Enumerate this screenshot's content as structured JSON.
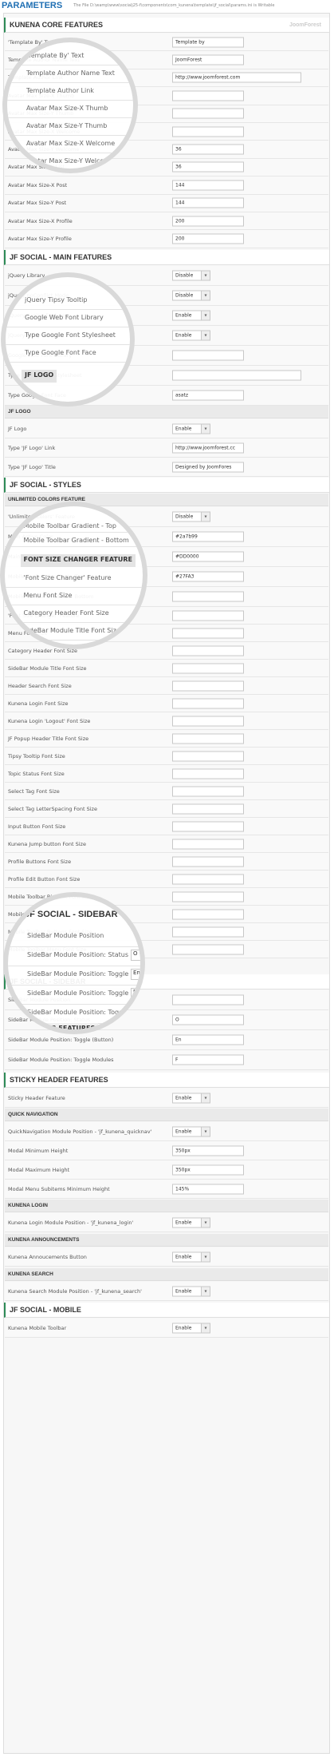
{
  "header": {
    "title": "PARAMETERS",
    "path": "The File D:\\wamp\\www\\socialj25-f\\components\\com_kunena\\template\\jf_social\\params.ini is Writable"
  },
  "logo_text": "JoomForest",
  "dropdown_arrow": "▾",
  "sections": {
    "core": "KUNENA CORE FEATURES",
    "main": "JF SOCIAL - MAIN FEATURES",
    "jflogo": "JF LOGO",
    "styles": "JF SOCIAL - STYLES",
    "unlimited": "UNLIMITED COLORS FEATURE",
    "sidebar": "JF SOCIAL - SIDEBAR",
    "sticky": "STICKY HEADER FEATURES",
    "quicknav": "QUICK NAVIGATION",
    "login": "KUNENA LOGIN",
    "announce": "KUNENA ANNOUNCEMENTS",
    "search": "KUNENA SEARCH",
    "mobile": "JF SOCIAL - MOBILE"
  },
  "core_rows": [
    {
      "label": "'Template By' Text",
      "value": "Template by"
    },
    {
      "label": "Template Author Name Text",
      "value": "JoomForest"
    },
    {
      "label": "Template Author Link",
      "value": "http://www.joomforest.com"
    },
    {
      "label": "Avatar Max Size-X Thumb",
      "value": ""
    },
    {
      "label": "Avatar Max Size-Y Thumb",
      "value": ""
    },
    {
      "label": "Avatar Max Size-X Welcome",
      "value": ""
    },
    {
      "label": "Avatar Max Size-Y Welcome",
      "value": "36"
    },
    {
      "label": "Avatar Max Size-Y List",
      "value": "36"
    },
    {
      "label": "Avatar Max Size-X Post",
      "value": "144"
    },
    {
      "label": "Avatar Max Size-Y Post",
      "value": "144"
    },
    {
      "label": "Avatar Max Size-X Profile",
      "value": "200"
    },
    {
      "label": "Avatar Max Size-Y Profile",
      "value": "200"
    }
  ],
  "main_rows": [
    {
      "label": "jQuery Library",
      "value": "Disable"
    },
    {
      "label": "jQuery noConflict Mode",
      "value": "Disable"
    },
    {
      "label": "jQuery Easing Features",
      "value": "Enable"
    },
    {
      "label": "jQuery Tipsy Tooltip",
      "value": "Enable"
    },
    {
      "label": "Google Web Font Library",
      "value": ""
    },
    {
      "label": "Type Google Font Stylesheet",
      "value": ""
    },
    {
      "label": "Type Google Font Face",
      "value": "asatz"
    }
  ],
  "logo_rows": [
    {
      "label": "JF Logo",
      "value": "Enable"
    },
    {
      "label": "Type 'JF Logo' Link",
      "value": "http://www.joomforest.cc"
    },
    {
      "label": "Type 'JF Logo' Title",
      "value": "Designed by JoomFores"
    }
  ],
  "styles_rows": [
    {
      "label": "'Unlimited Colors' Feature",
      "value": "Disable"
    },
    {
      "label": "Main Active Color",
      "value": "#2a7b99"
    },
    {
      "label": "Main Inactive Color",
      "value": "#DD0000"
    },
    {
      "label": "Mobile Toolbar Gradient - Top",
      "value": "#27FA3"
    },
    {
      "label": "Mobile Toolbar Gradient - Bottom",
      "value": ""
    }
  ],
  "font_rows": [
    {
      "label": "'Font Size Changer' Feature",
      "value": ""
    },
    {
      "label": "Menu Font Size",
      "value": ""
    },
    {
      "label": "Category Header Font Size",
      "value": ""
    },
    {
      "label": "SideBar Module Title Font Size",
      "value": ""
    },
    {
      "label": "Header Search Font Size",
      "value": ""
    },
    {
      "label": "Kunena Login Font Size",
      "value": ""
    },
    {
      "label": "Kunena Login 'Logout' Font Size",
      "value": ""
    },
    {
      "label": "JF Popup Header Title Font Size",
      "value": ""
    },
    {
      "label": "Tipsy Tooltip Font Size",
      "value": ""
    },
    {
      "label": "Topic Status Font Size",
      "value": ""
    },
    {
      "label": "Select Tag Font Size",
      "value": ""
    },
    {
      "label": "Select Tag LetterSpacing Font Size",
      "value": ""
    },
    {
      "label": "Input Button Font Size",
      "value": ""
    },
    {
      "label": "Kunena Jump button Font Size",
      "value": ""
    },
    {
      "label": "Profile Buttons Font Size",
      "value": ""
    },
    {
      "label": "Profile Edit Button Font Size",
      "value": ""
    },
    {
      "label": "Mobile Toolbar Big Text Font Size",
      "value": ""
    },
    {
      "label": "Mobile Toolbar Small Text Font Size",
      "value": ""
    },
    {
      "label": "Mobile Toolbar Buttons Font Size",
      "value": ""
    },
    {
      "label": "Mobile Toolbar Menu Font Size",
      "value": ""
    }
  ],
  "sidebar_rows": [
    {
      "label": "SideBar Module Position",
      "value": ""
    },
    {
      "label": "SideBar Module Position: Status",
      "value": "O"
    },
    {
      "label": "SideBar Module Position: Toggle (Button)",
      "value": "En"
    },
    {
      "label": "SideBar Module Position: Toggle Modules",
      "value": "F"
    }
  ],
  "sticky_rows": [
    {
      "label": "Sticky Header Feature",
      "value": "Enable"
    }
  ],
  "quicknav_rows": [
    {
      "label": "QuickNavigation Module Position - 'jf_kunena_quicknav'",
      "value": "Enable"
    },
    {
      "label": "Modal Minimum Height",
      "value": "350px"
    },
    {
      "label": "Modal Maximum Height",
      "value": "350px"
    },
    {
      "label": "Modal Menu Subitems Minimum Height",
      "value": "145%"
    }
  ],
  "login_rows": [
    {
      "label": "Kunena Login Module Position - 'jf_kunena_login'",
      "value": "Enable"
    }
  ],
  "announce_rows": [
    {
      "label": "Kunena Annoucements Button",
      "value": "Enable"
    }
  ],
  "search_rows": [
    {
      "label": "Kunena Search Module Position - 'jf_kunena_search'",
      "value": "Enable"
    }
  ],
  "mobile_rows": [
    {
      "label": "Kunena Mobile Toolbar",
      "value": "Enable"
    }
  ],
  "magnifiers": {
    "m1": [
      "'Template By' Text",
      "Template Author Name Text",
      "Template Author Link",
      "Avatar Max Size-X Thumb",
      "Avatar Max Size-Y Thumb",
      "Avatar Max Size-X Welcome",
      "Avatar Max Size-Y Welcome"
    ],
    "m2": [
      "jQuery Tipsy Tooltip",
      "Google Web Font Library",
      "Type Google Font Stylesheet",
      "Type Google Font Face"
    ],
    "m2_head": "JF LOGO",
    "m3_top": [
      "Mobile Toolbar Gradient - Top",
      "Mobile Toolbar Gradient - Bottom"
    ],
    "m3_head": "FONT SIZE CHANGER FEATURE",
    "m3": [
      "'Font Size Changer' Feature",
      "Menu Font Size",
      "Category Header Font Size",
      "SideBar Module Title Font Size"
    ],
    "m4_sec": "JF SOCIAL - SIDEBAR",
    "m4": [
      "SideBar Module Position",
      "SideBar Module Position: Status",
      "SideBar Module Position: Toggle (Button)",
      "SideBar Module Position: Toggle Modules",
      "SideBar Module Position: Toggle Modules - Status"
    ],
    "m4_ctl": [
      "O",
      "En",
      "F"
    ],
    "m4_head": "HEADER FEATURES"
  }
}
